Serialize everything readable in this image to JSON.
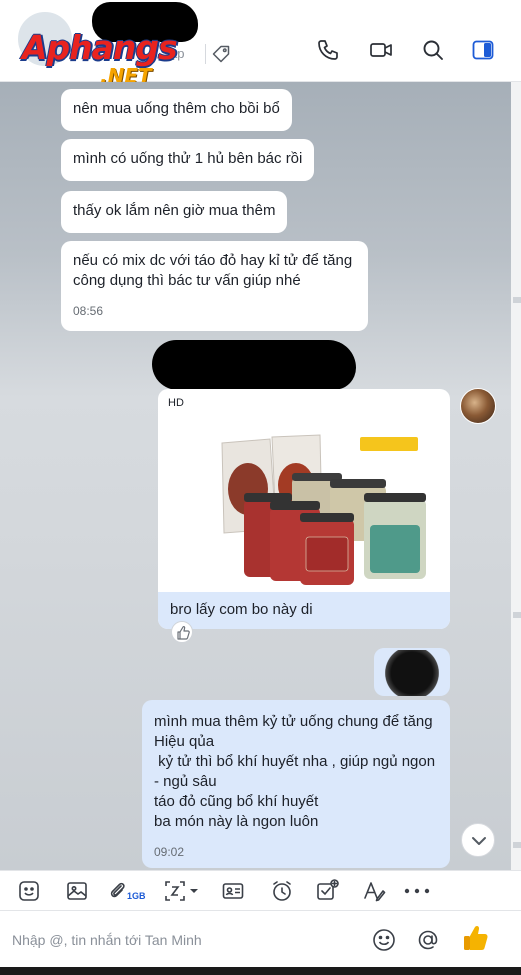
{
  "header": {
    "status_text": "ập",
    "watermark_brand": "Aphangs",
    "watermark_tld": ".NET",
    "icons": [
      "tag-icon",
      "phone-icon",
      "video-icon",
      "search-icon",
      "sidebar-toggle-icon"
    ]
  },
  "messages": {
    "received": [
      {
        "text": "nên mua uống thêm cho bồi bổ"
      },
      {
        "text": "mình có uống thử 1 hủ bên bác rồi"
      },
      {
        "text": "thấy ok lắm nên giờ mua thêm"
      },
      {
        "line1": "nếu có mix dc với táo đỏ hay kỉ tử để tăng",
        "line2": "công dụng thì bác tư vấn giúp nhé",
        "time": "08:56"
      }
    ],
    "image_message": {
      "quality_label": "HD",
      "caption": "bro lấy com bo này di",
      "reaction_icon": "thumbs-up-icon"
    },
    "sent": {
      "lines": [
        "mình mua thêm kỷ tử uống chung để tăng",
        "Hiệu qủa",
        " kỷ tử thì bổ khí huyết nha , giúp ngủ ngon",
        "- ngủ sâu",
        "táo đỏ cũng bổ khí huyết",
        "ba món này là ngon luôn"
      ],
      "time": "09:02"
    }
  },
  "toolbar": {
    "file_size_label": "1GB",
    "icons": [
      "sticker-icon",
      "image-icon",
      "attachment-icon",
      "screenshot-icon",
      "contact-card-icon",
      "reminder-clock-icon",
      "task-check-icon",
      "text-format-icon",
      "more-icon"
    ]
  },
  "composer": {
    "placeholder": "Nhập @, tin nhắn tới Tan Minh",
    "value": "",
    "icons": [
      "emoji-icon",
      "mention-icon",
      "quick-like-icon"
    ]
  },
  "colors": {
    "accent": "#1d5bd6",
    "sent_bubble": "#dbe8fb",
    "received_bubble": "#ffffff",
    "like_yellow": "#f5b301"
  }
}
